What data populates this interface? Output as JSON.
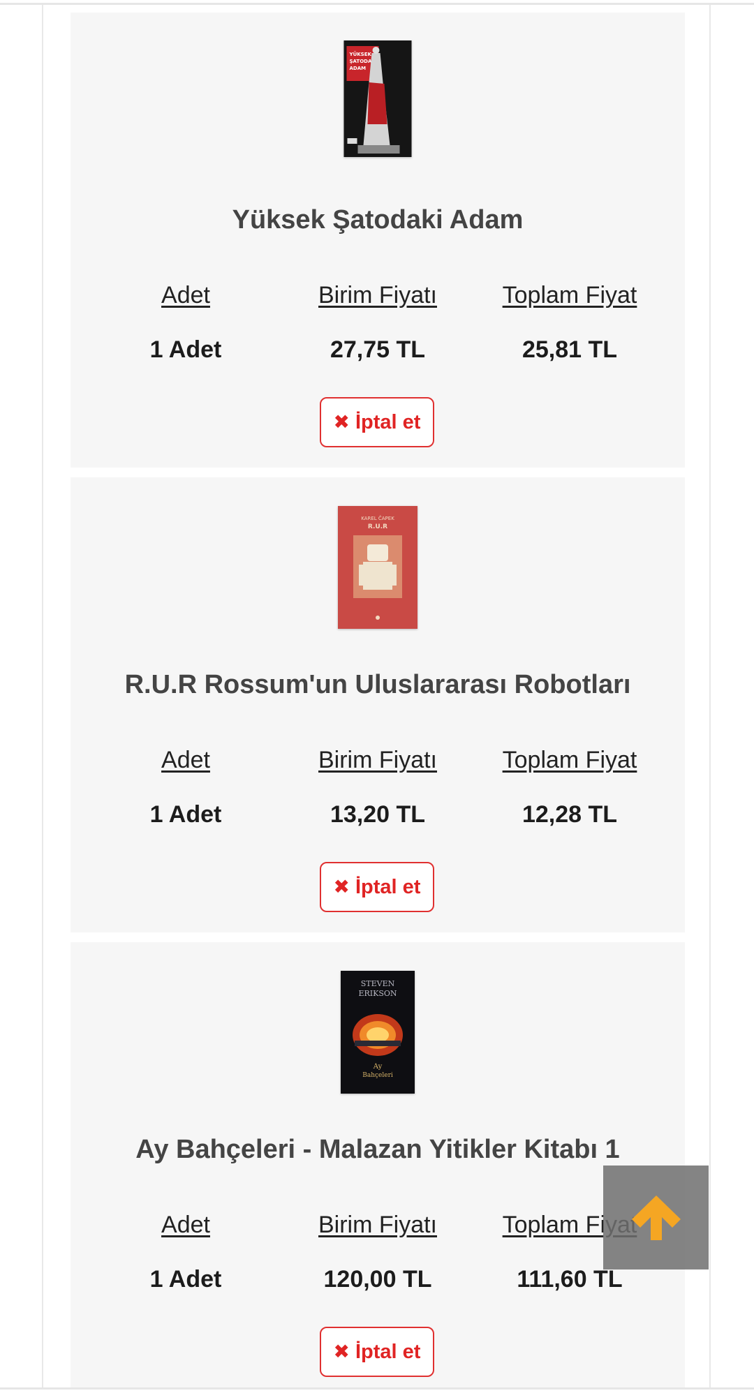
{
  "headers": {
    "qty": "Adet",
    "unit_price": "Birim Fiyatı",
    "total_price": "Toplam Fiyat"
  },
  "cancel_label": "İptal et",
  "cancel_icon": "close-icon",
  "scroll_top_icon": "arrow-up-icon",
  "colors": {
    "accent_red": "#e02424",
    "scroll_arrow": "#f5a623",
    "card_bg": "#f6f6f6"
  },
  "items": [
    {
      "title": "Yüksek Şatodaki Adam",
      "qty": "1 Adet",
      "unit_price": "27,75 TL",
      "total_price": "25,81 TL",
      "cover_text": "YÜKSEK ŞATODAKİ ADAM"
    },
    {
      "title": "R.U.R Rossum'un Uluslararası Robotları",
      "qty": "1 Adet",
      "unit_price": "13,20 TL",
      "total_price": "12,28 TL",
      "cover_text": "R.U.R"
    },
    {
      "title": "Ay Bahçeleri - Malazan Yitikler Kitabı 1",
      "qty": "1 Adet",
      "unit_price": "120,00 TL",
      "total_price": "111,60 TL",
      "cover_text": "STEVEN ERIKSON"
    }
  ]
}
